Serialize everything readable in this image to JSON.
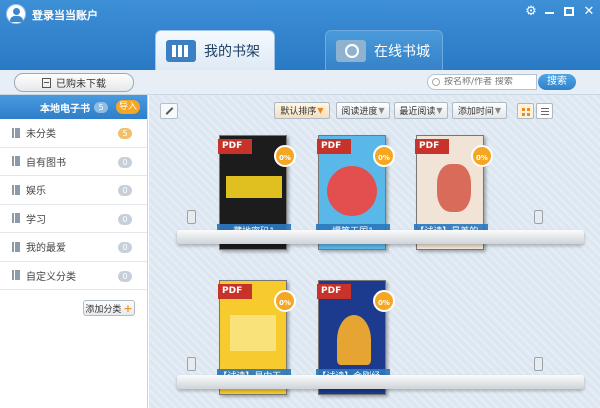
{
  "header": {
    "login_text": "登录当当账户",
    "tabs": [
      {
        "label": "我的书架",
        "active": true
      },
      {
        "label": "在线书城",
        "active": false
      }
    ]
  },
  "toolbar": {
    "purchased_label": "已购未下载",
    "search_placeholder": "按名称/作者 搜索",
    "search_button": "搜索"
  },
  "sidebar": {
    "title": "本地电子书",
    "count": "5",
    "import_label": "导入",
    "items": [
      {
        "label": "未分类",
        "count": "5"
      },
      {
        "label": "自有图书",
        "count": "0"
      },
      {
        "label": "娱乐",
        "count": "0"
      },
      {
        "label": "学习",
        "count": "0"
      },
      {
        "label": "我的最爱",
        "count": "0"
      },
      {
        "label": "自定义分类",
        "count": "0"
      }
    ],
    "add_category_label": "添加分类"
  },
  "main": {
    "sort_buttons": [
      {
        "label": "默认排序",
        "active": true
      },
      {
        "label": "阅读进度",
        "active": false
      },
      {
        "label": "最近阅读",
        "active": false
      },
      {
        "label": "添加时间",
        "active": false
      }
    ],
    "view_mode": "grid",
    "books": [
      {
        "title": "藏地密码1",
        "format": "PDF",
        "progress": "0%"
      },
      {
        "title": "爆笑王国1",
        "format": "PDF",
        "progress": "0%"
      },
      {
        "title": "【试读】最美的...",
        "format": "PDF",
        "progress": "0%"
      },
      {
        "title": "【试读】易中天...",
        "format": "PDF",
        "progress": "0%"
      },
      {
        "title": "【试读】金刚经...",
        "format": "PDF",
        "progress": "0%"
      }
    ]
  },
  "colors": {
    "header_blue": "#2a79c4",
    "accent_orange": "#f5a623",
    "pdf_red": "#c7332a"
  }
}
